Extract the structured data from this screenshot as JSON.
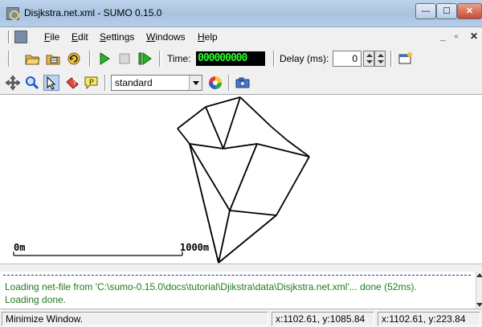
{
  "window": {
    "title": "Disjkstra.net.xml - SUMO 0.15.0"
  },
  "menu": {
    "items": [
      {
        "underline": "F",
        "rest": "ile"
      },
      {
        "underline": "E",
        "rest": "dit"
      },
      {
        "underline": "S",
        "rest": "ettings"
      },
      {
        "underline": "W",
        "rest": "indows"
      },
      {
        "underline": "H",
        "rest": "elp"
      }
    ]
  },
  "toolbar": {
    "time_label": "Time:",
    "time_value": "000000000",
    "delay_label": "Delay (ms):",
    "delay_value": "0",
    "scheme_value": "standard"
  },
  "canvas": {
    "scale_start": "0m",
    "scale_end": "1000m"
  },
  "log": {
    "line1": "Loading net-file from 'C:\\sumo-0.15.0\\docs\\tutorial\\Djikstra\\data\\Disjkstra.net.xml'...  done (52ms).",
    "line2": "Loading done."
  },
  "status": {
    "message": "Minimize Window.",
    "coord1": "x:1102.61, y:1085.84",
    "coord2": "x:1102.61, y:223.84"
  },
  "colors": {
    "time_digits": "#2aff2a",
    "log_text": "#1e7a1e"
  }
}
